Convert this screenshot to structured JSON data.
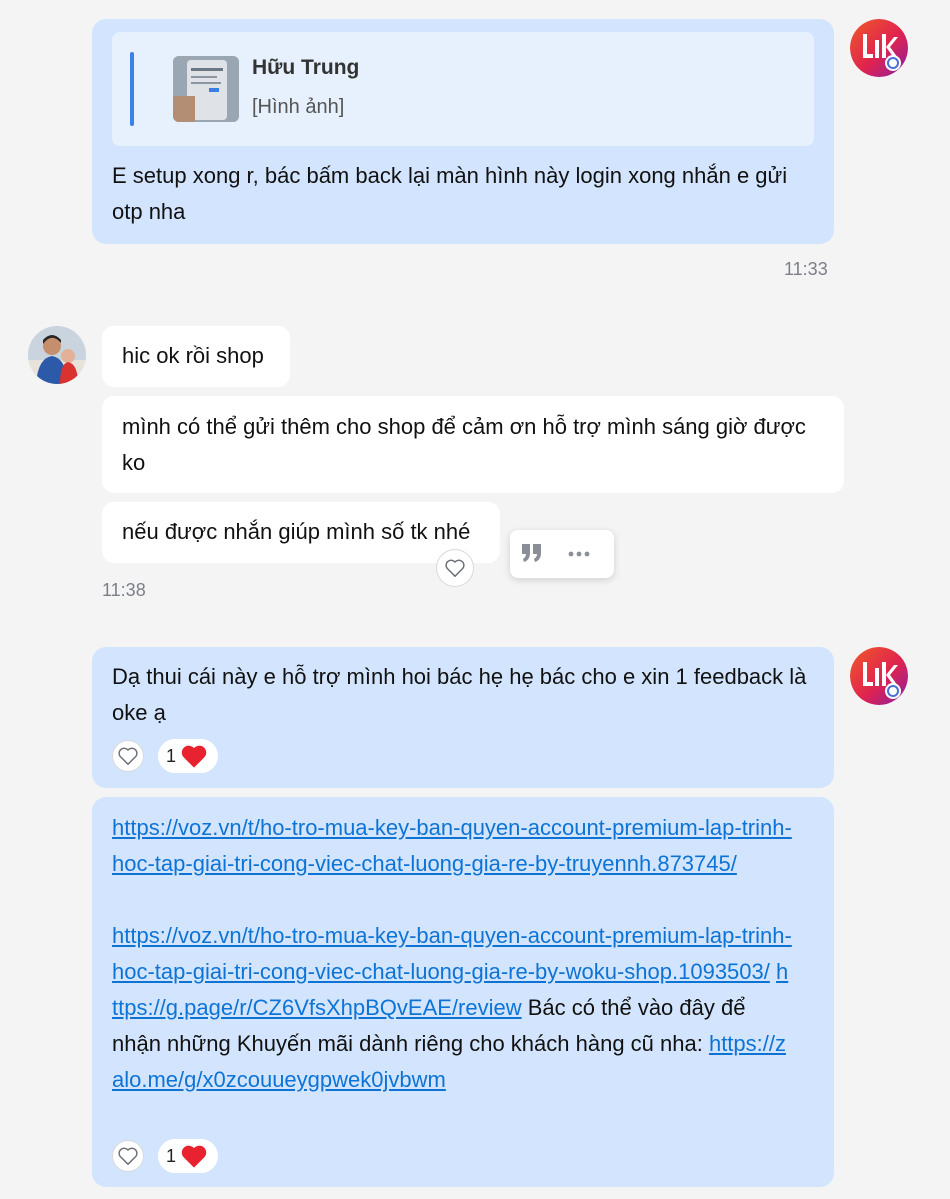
{
  "messages": {
    "m1": {
      "quote_name": "Hữu Trung",
      "quote_sub": "[Hình ảnh]",
      "text": "E setup xong r, bác bấm back lại màn hình này login xong nhắn e gửi otp nha",
      "time": "11:33"
    },
    "m2": {
      "text": "hic ok rồi shop"
    },
    "m3": {
      "text": "mình có thể gửi thêm cho shop để cảm ơn hỗ trợ mình sáng giờ được ko"
    },
    "m4": {
      "text": "nếu được nhắn giúp mình số tk nhé",
      "time": "11:38"
    },
    "m5": {
      "text": "Dạ thui cái này e hỗ trợ mình hoi bác hẹ hẹ bác cho e xin 1 feedback là oke ạ",
      "reaction_count": "1"
    },
    "m6": {
      "link1": "https://voz.vn/t/ho-tro-mua-key-ban-quyen-account-premium-lap-trinh-hoc-tap-giai-tri-cong-viec-chat-luong-gia-re-by-truyennh.873745/",
      "link2": "https://voz.vn/t/ho-tro-mua-key-ban-quyen-account-premium-lap-trinh-hoc-tap-giai-tri-cong-viec-chat-luong-gia-re-by-woku-shop.1093503/",
      "link3": "https://g.page/r/CZ6VfsXhpBQvEAE/review",
      "text_before_link4": "Bác có thể vào đây để nhận những Khuyến mãi dành riêng cho khách hàng cũ nha: ",
      "link4": "https://zalo.me/g/x0zcouueygpwek0jvbwm",
      "reaction_count": "1"
    }
  },
  "icons": {
    "like": "heart-outline-icon",
    "reaction": "heart-icon",
    "quote": "quote-icon",
    "more": "more-icon"
  },
  "colors": {
    "my_bubble": "#d3e5fe",
    "other_bubble": "#ffffff",
    "link": "#0d74d6",
    "heart": "#e8232f"
  }
}
